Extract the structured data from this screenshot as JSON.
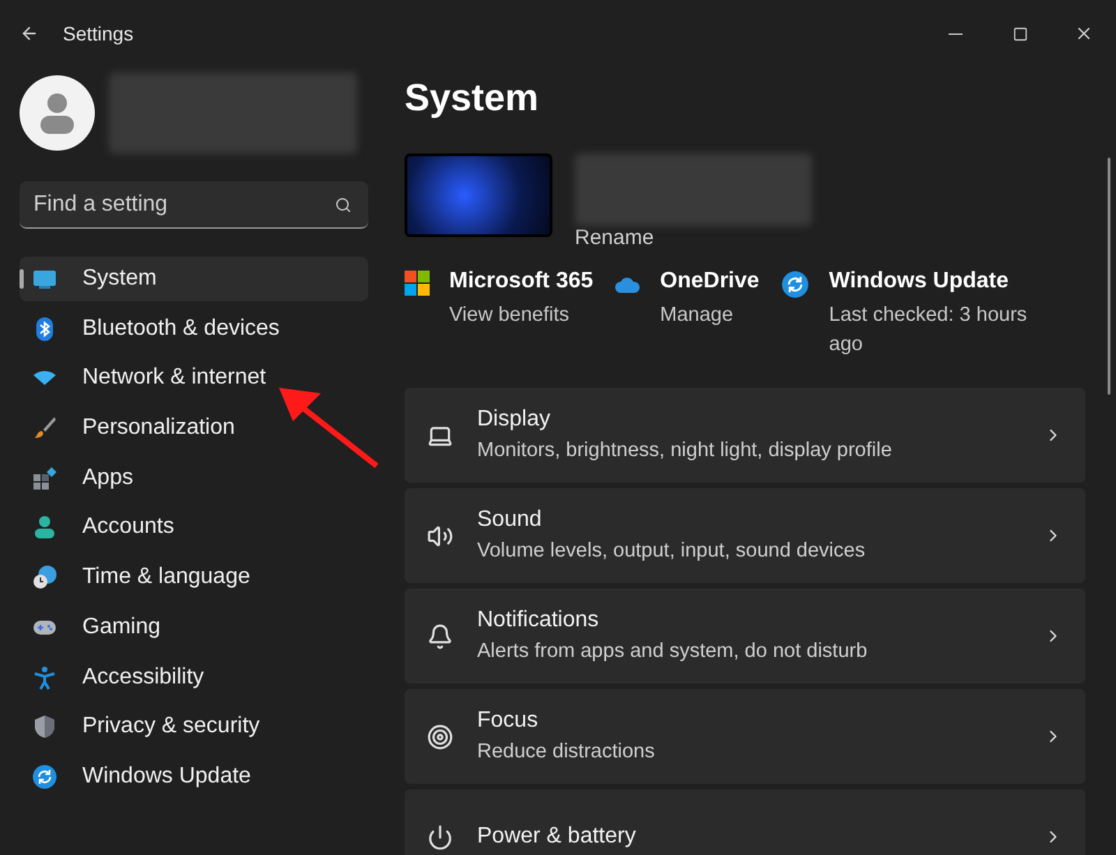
{
  "window": {
    "title": "Settings"
  },
  "search": {
    "placeholder": "Find a setting"
  },
  "sidebar": {
    "items": [
      {
        "label": "System",
        "selected": true
      },
      {
        "label": "Bluetooth & devices",
        "selected": false
      },
      {
        "label": "Network & internet",
        "selected": false
      },
      {
        "label": "Personalization",
        "selected": false
      },
      {
        "label": "Apps",
        "selected": false
      },
      {
        "label": "Accounts",
        "selected": false
      },
      {
        "label": "Time & language",
        "selected": false
      },
      {
        "label": "Gaming",
        "selected": false
      },
      {
        "label": "Accessibility",
        "selected": false
      },
      {
        "label": "Privacy & security",
        "selected": false
      },
      {
        "label": "Windows Update",
        "selected": false
      }
    ]
  },
  "page": {
    "title": "System",
    "rename": "Rename"
  },
  "quick_links": [
    {
      "title": "Microsoft 365",
      "subtitle": "View benefits"
    },
    {
      "title": "OneDrive",
      "subtitle": "Manage"
    },
    {
      "title": "Windows Update",
      "subtitle": "Last checked: 3 hours ago"
    }
  ],
  "settings": [
    {
      "title": "Display",
      "subtitle": "Monitors, brightness, night light, display profile"
    },
    {
      "title": "Sound",
      "subtitle": "Volume levels, output, input, sound devices"
    },
    {
      "title": "Notifications",
      "subtitle": "Alerts from apps and system, do not disturb"
    },
    {
      "title": "Focus",
      "subtitle": "Reduce distractions"
    },
    {
      "title": "Power & battery"
    }
  ]
}
